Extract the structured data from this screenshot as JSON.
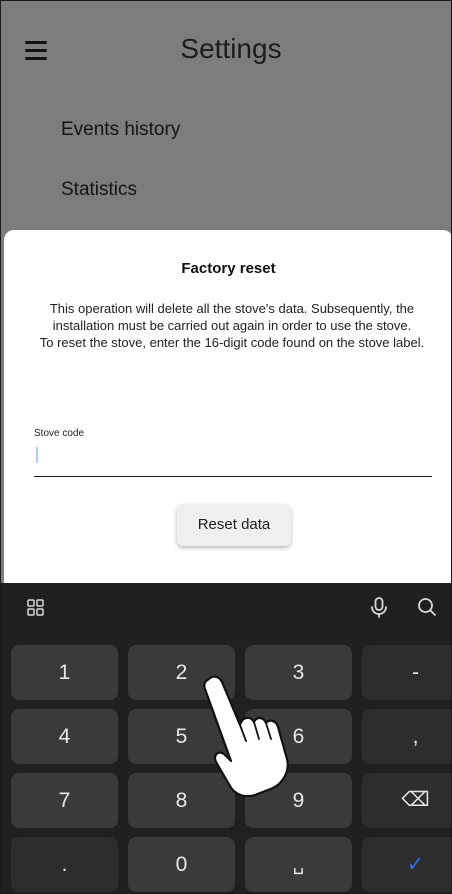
{
  "header": {
    "title": "Settings",
    "menu_icon": "hamburger-menu-icon"
  },
  "menu": {
    "items": [
      {
        "label": "Events history"
      },
      {
        "label": "Statistics"
      }
    ]
  },
  "dialog": {
    "title": "Factory reset",
    "body_line1": "This operation will delete all the stove's data. Subsequently, the installation must be carried out again in order to use the stove.",
    "body_line2": "To reset the stove, enter the 16-digit code found on the stove label.",
    "field_label": "Stove code",
    "field_value": "",
    "button_label": "Reset data"
  },
  "keyboard": {
    "toolbar": {
      "grid_icon": "apps-grid-icon",
      "mic_icon": "microphone-icon",
      "search_icon": "search-icon"
    },
    "keys": [
      "1",
      "2",
      "3",
      "-",
      "4",
      "5",
      "6",
      ",",
      "7",
      "8",
      "9",
      "⌫",
      ".",
      "0",
      "␣",
      "✓"
    ],
    "colors": {
      "background": "#202020",
      "key": "#3a3a3a",
      "accent": "#2f6ee8"
    }
  },
  "colors": {
    "overlay": "#7d7d7d",
    "dialog": "#ffffff",
    "caret": "#b6cdf3"
  }
}
